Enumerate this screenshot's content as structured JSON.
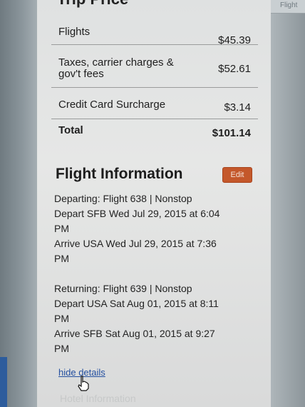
{
  "background": {
    "right_label": "Flight"
  },
  "header": {
    "cut_title": "Trip Price"
  },
  "price_rows": [
    {
      "label": "Flights",
      "value": "$45.39"
    },
    {
      "label": "Taxes, carrier charges &\ngov't fees",
      "value": "$52.61"
    },
    {
      "label": "Credit Card Surcharge",
      "value": "$3.14"
    },
    {
      "label": "Total",
      "value": "$101.14"
    }
  ],
  "flight_info": {
    "title": "Flight Information",
    "edit_label": "Edit",
    "departing": {
      "line1": "Departing: Flight 638 | Nonstop",
      "line2": "Depart SFB Wed Jul 29, 2015 at 6:04",
      "line3": "PM",
      "line4": "Arrive USA Wed Jul 29, 2015 at 7:36",
      "line5": "PM"
    },
    "returning": {
      "line1": "Returning: Flight 639 | Nonstop",
      "line2": "Depart USA Sat Aug 01, 2015 at 8:11",
      "line3": "PM",
      "line4": "Arrive SFB Sat Aug 01, 2015 at 9:27",
      "line5": "PM"
    },
    "hide_details_link": "hide details"
  },
  "next_section_faded": "Hotel Information"
}
